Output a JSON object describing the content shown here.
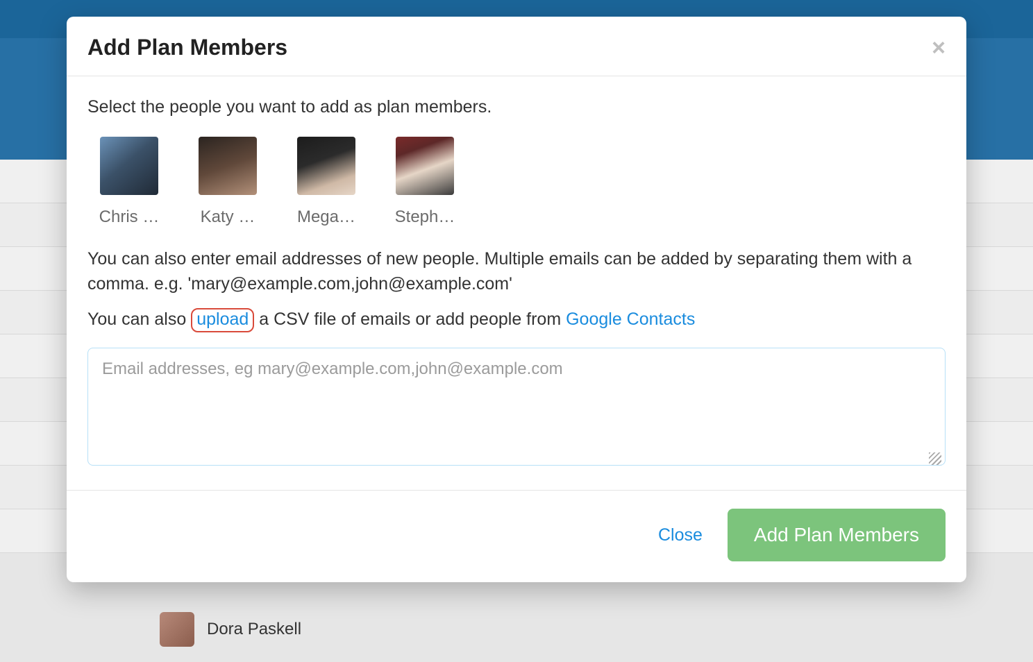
{
  "modal": {
    "title": "Add Plan Members",
    "instruction": "Select the people you want to add as plan members.",
    "people": [
      {
        "name": "Chris …"
      },
      {
        "name": "Katy …"
      },
      {
        "name": "Mega…"
      },
      {
        "name": "Steph…"
      }
    ],
    "email_note": "You can also enter email addresses of new people. Multiple emails can be added by separating them with a comma. e.g. 'mary@example.com,john@example.com'",
    "csv_prefix": "You can also ",
    "upload_link": "upload",
    "csv_mid": " a CSV file of emails or add people from ",
    "google_link": "Google Contacts",
    "email_placeholder": "Email addresses, eg mary@example.com,john@example.com",
    "close_label": "Close",
    "submit_label": "Add Plan Members"
  },
  "backdrop": {
    "person_name": "Dora Paskell"
  }
}
